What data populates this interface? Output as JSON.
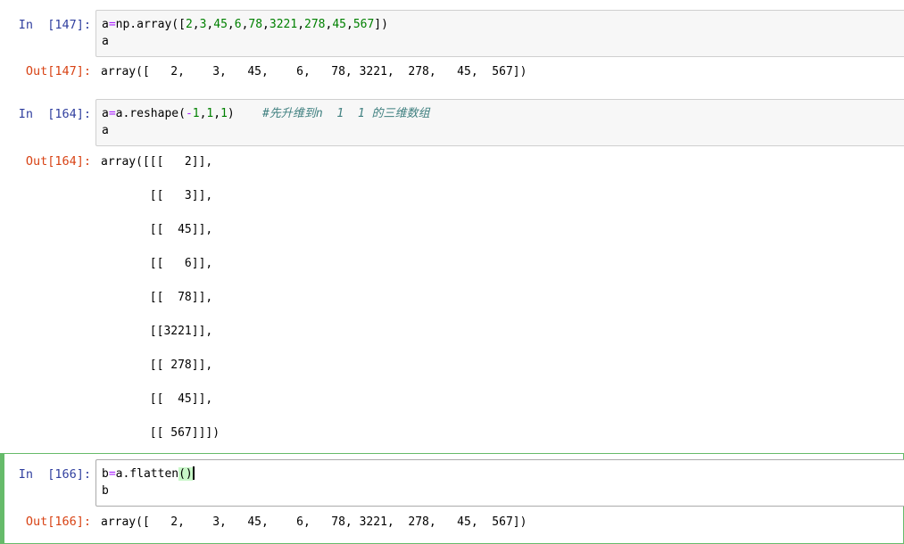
{
  "cells": [
    {
      "in_prompt": "In  [147]:",
      "code": {
        "line1": {
          "a": "a",
          "eq": "=",
          "np": "np.",
          "fn": "array",
          "open": "([",
          "n1": "2",
          "c1": ",",
          "n2": "3",
          "c2": ",",
          "n3": "45",
          "c3": ",",
          "n4": "6",
          "c4": ",",
          "n5": "78",
          "c5": ",",
          "n6": "3221",
          "c6": ",",
          "n7": "278",
          "c7": ",",
          "n8": "45",
          "c8": ",",
          "n9": "567",
          "close": "])"
        },
        "line2": "a"
      },
      "out_prompt": "Out[147]:",
      "output": [
        "array([   2,    3,   45,    6,   78, 3221,  278,   45,  567])"
      ]
    },
    {
      "in_prompt": "In  [164]:",
      "code": {
        "line1": {
          "a": "a",
          "eq": "=",
          "rest": "a.reshape(",
          "minus": "-",
          "n1": "1",
          "c1": ",",
          "n2": "1",
          "c2": ",",
          "n3": "1",
          "close": ")",
          "comment": "#先升维到n  1  1 的三维数组"
        },
        "line2": "a"
      },
      "out_prompt": "Out[164]:",
      "output": [
        "array([[[   2]],",
        "       [[   3]],",
        "       [[  45]],",
        "       [[   6]],",
        "       [[  78]],",
        "       [[3221]],",
        "       [[ 278]],",
        "       [[  45]],",
        "       [[ 567]]])"
      ]
    },
    {
      "in_prompt": "In  [166]:",
      "code": {
        "line1": {
          "b": "b",
          "eq": "=",
          "rest": "a.flatten",
          "paren": "()"
        },
        "line2": "b"
      },
      "out_prompt": "Out[166]:",
      "output": [
        "array([   2,    3,   45,    6,   78, 3221,  278,   45,  567])"
      ]
    }
  ],
  "colors": {
    "in_prompt": "#303f9f",
    "out_prompt": "#d84315",
    "selected_border": "#66bb6a",
    "number": "#008000",
    "operator": "#aa22ff",
    "comment": "#408080"
  }
}
